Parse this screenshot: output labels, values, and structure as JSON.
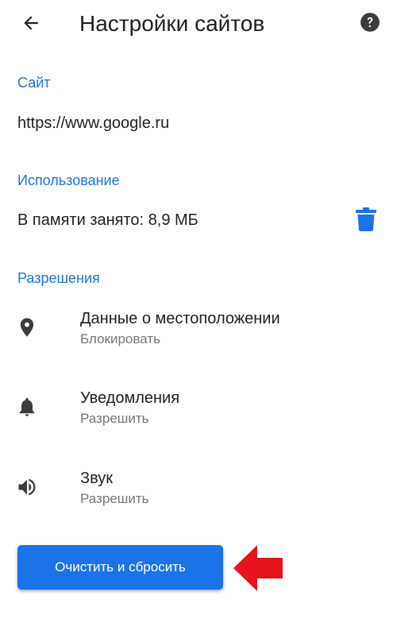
{
  "appbar": {
    "title": "Настройки сайтов",
    "back_icon": "arrow-back-icon",
    "help_icon": "help-circle-icon"
  },
  "site": {
    "header": "Сайт",
    "url": "https://www.google.ru"
  },
  "usage": {
    "header": "Использование",
    "storage_text": "В памяти занято: 8,9 МБ",
    "delete_icon": "trash-icon"
  },
  "permissions": {
    "header": "Разрешения",
    "items": [
      {
        "title": "Данные о местоположении",
        "value": "Блокировать",
        "icon": "location-pin-icon"
      },
      {
        "title": "Уведомления",
        "value": "Разрешить",
        "icon": "bell-icon"
      },
      {
        "title": "Звук",
        "value": "Разрешить",
        "icon": "speaker-icon"
      }
    ]
  },
  "actions": {
    "reset_label": "Очистить и сбросить"
  },
  "colors": {
    "accent": "#1a73e8",
    "annotation_arrow": "#e8141c"
  }
}
